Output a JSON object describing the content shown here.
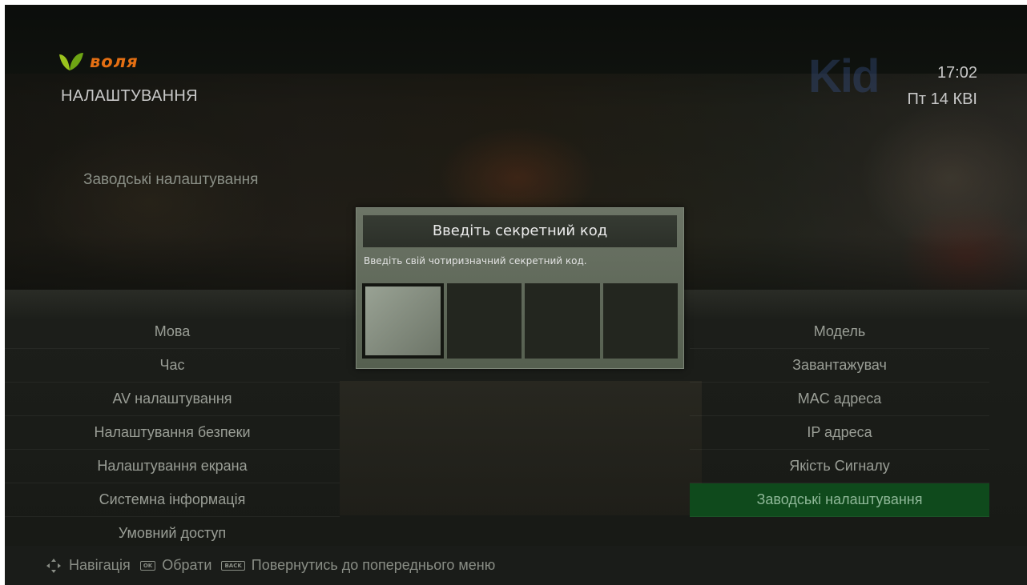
{
  "header": {
    "brand": "воля",
    "title": "НАЛАШТУВАННЯ",
    "time": "17:02",
    "date": "Пт 14 КВІ",
    "brand_color": "#e46f13"
  },
  "section_caption": "Заводські налаштування",
  "menu_left": {
    "items": [
      "Мова",
      "Час",
      "AV налаштування",
      "Налаштування безпеки",
      "Налаштування екрана",
      "Системна інформація",
      "Умовний доступ"
    ]
  },
  "menu_right": {
    "items": [
      "Модель",
      "Завантажувач",
      "MAC адреса",
      "IP адреса",
      "Якість Сигналу",
      "Заводські налаштування"
    ],
    "selected": "Заводські налаштування",
    "selected_color": "#0f4a1c"
  },
  "dialog": {
    "title": "Введіть секретний код",
    "description": "Введіть свій чотиризначний секретний код.",
    "code_digits": [
      "",
      "",
      "",
      ""
    ],
    "active_digit": 1
  },
  "hints": {
    "navigation_icon": "dpad-icon",
    "navigation_label": "Навігація",
    "ok_key": "OK",
    "ok_label": "Обрати",
    "back_key": "BACK",
    "back_label": "Повернутись до попереднього меню"
  }
}
